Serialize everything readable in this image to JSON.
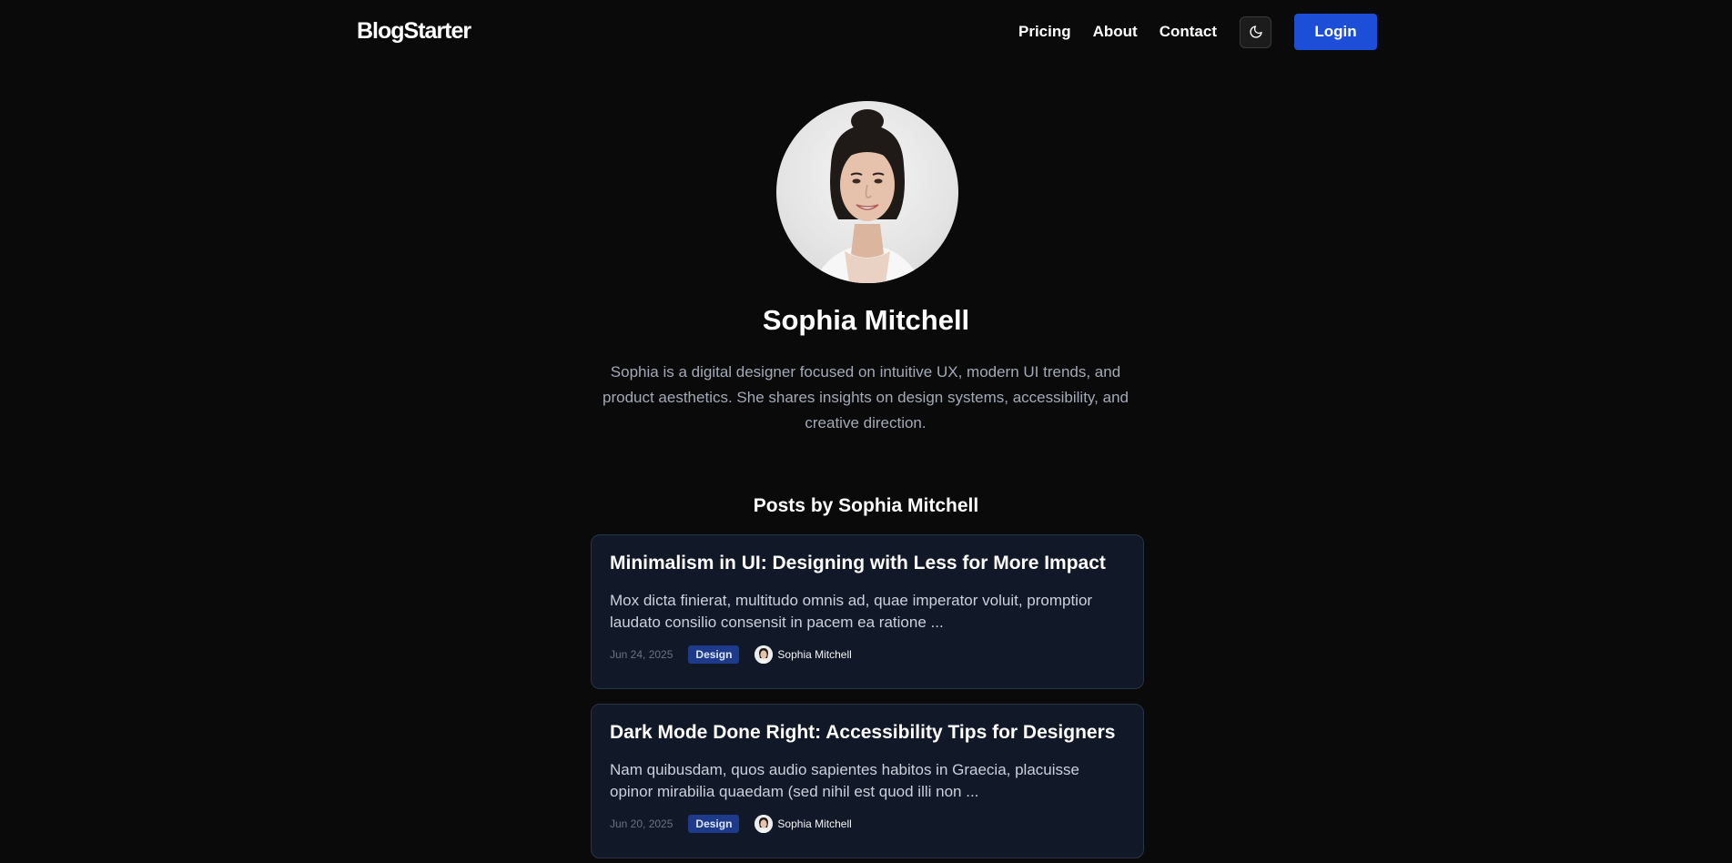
{
  "header": {
    "brand": "BlogStarter",
    "nav": [
      {
        "label": "Pricing"
      },
      {
        "label": "About"
      },
      {
        "label": "Contact"
      }
    ],
    "theme_toggle_icon": "moon-icon",
    "login_label": "Login"
  },
  "profile": {
    "name": "Sophia Mitchell",
    "bio": "Sophia is a digital designer focused on intuitive UX, modern UI trends, and product aesthetics. She shares insights on design systems, accessibility, and creative direction.",
    "posts_heading": "Posts by Sophia Mitchell"
  },
  "posts": [
    {
      "title": "Minimalism in UI: Designing with Less for More Impact",
      "excerpt": "Mox dicta finierat, multitudo omnis ad, quae imperator voluit, promptior laudato consilio consensit in pacem ea ratione ...",
      "date": "Jun 24, 2025",
      "category": "Design",
      "author": "Sophia Mitchell"
    },
    {
      "title": "Dark Mode Done Right: Accessibility Tips for Designers",
      "excerpt": "Nam quibusdam, quos audio sapientes habitos in Graecia, placuisse opinor mirabilia quaedam (sed nihil est quod illi non ...",
      "date": "Jun 20, 2025",
      "category": "Design",
      "author": "Sophia Mitchell"
    }
  ],
  "colors": {
    "background": "#0a0a0a",
    "accent": "#1d4ed8",
    "card": "#111827",
    "badge": "#1e3a8a"
  }
}
